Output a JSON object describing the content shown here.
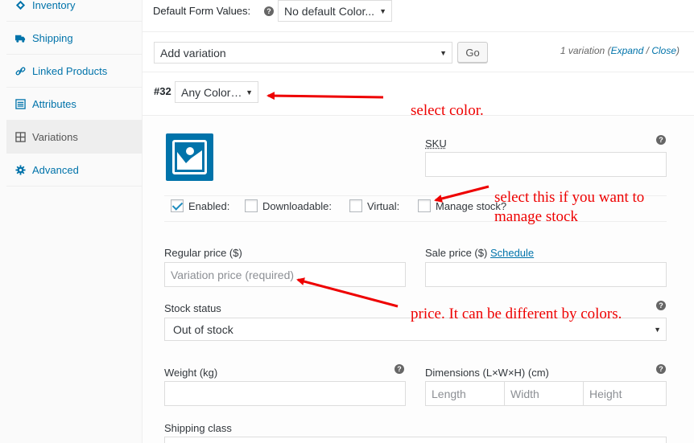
{
  "sidebar": {
    "items": [
      {
        "label": "Inventory",
        "icon": "inventory-icon"
      },
      {
        "label": "Shipping",
        "icon": "truck-icon"
      },
      {
        "label": "Linked Products",
        "icon": "link-icon"
      },
      {
        "label": "Attributes",
        "icon": "list-icon"
      },
      {
        "label": "Variations",
        "icon": "grid-icon",
        "active": true
      },
      {
        "label": "Advanced",
        "icon": "gear-icon"
      }
    ]
  },
  "defaults": {
    "label": "Default Form Values:",
    "select_value": "No default Color..."
  },
  "toolbar": {
    "add_select": "Add variation",
    "go_label": "Go",
    "count_text": "1 variation",
    "expand": "Expand",
    "separator": "/",
    "close": "Close",
    "open_paren": "(",
    "close_paren": ")"
  },
  "variation": {
    "number": "#32",
    "color_select": "Any Color…",
    "sku_label": "SKU",
    "enabled_label": "Enabled:",
    "downloadable_label": "Downloadable:",
    "virtual_label": "Virtual:",
    "manage_stock_label": "Manage stock?",
    "regular_price_label": "Regular price ($)",
    "regular_price_placeholder": "Variation price (required)",
    "sale_price_label": "Sale price ($)",
    "schedule_link": "Schedule",
    "stock_status_label": "Stock status",
    "stock_status_value": "Out of stock",
    "weight_label": "Weight (kg)",
    "dimensions_label": "Dimensions (L×W×H) (cm)",
    "length_placeholder": "Length",
    "width_placeholder": "Width",
    "height_placeholder": "Height",
    "shipping_class_label": "Shipping class"
  },
  "annotations": {
    "color": "select color.",
    "manage_line1": "select this if you want to",
    "manage_line2": "manage stock",
    "price": "price. It can be different by colors."
  },
  "colors": {
    "link": "#0073aa",
    "annotation": "#ee0000",
    "thumbnail": "#0073aa"
  }
}
